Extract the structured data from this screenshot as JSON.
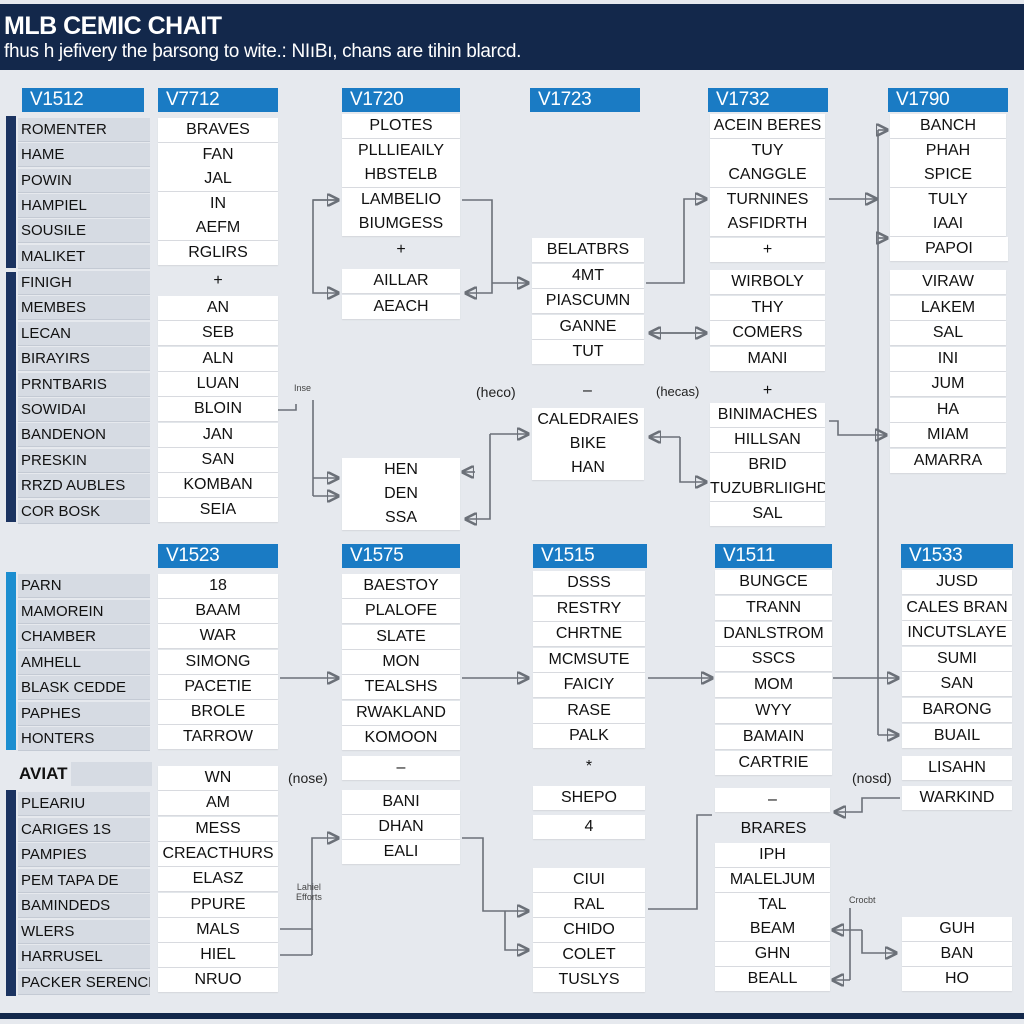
{
  "header": {
    "title": "MLB CEMIC CHAIT",
    "subtitle": "fhus h jefivery the þarsong to wite.: NIıBı, chans are tihin blarcd."
  },
  "colors": {
    "header_bg": "#13284b",
    "column_header": "#1a7bc4",
    "sidebar_dark": "#1b3360",
    "sidebar_blue": "#1c8ed0",
    "background": "#e6e9ee"
  },
  "top_section": {
    "group1": {
      "header": "V1512",
      "labels": [
        "ROMENTER",
        "HAME",
        "POWIN",
        "HAMPIEL",
        "SOUSILE",
        "MALIKET"
      ]
    },
    "group2": {
      "labels": [
        "FINIGH",
        "MEMBES",
        "LECAN",
        "BIRAYIRS",
        "PRNTBARIS",
        "SOWIDAI",
        "BANDENON",
        "PRESKIN",
        "RRZD AUBLES",
        "COR BOSK"
      ]
    },
    "col_v7712": {
      "header": "V7712",
      "values_a": [
        "BRAVES",
        "FAN",
        "JAL",
        "IN",
        "AEFM",
        "RGLIRS"
      ],
      "separator": "+",
      "values_b": [
        "AN",
        "SEB",
        "ALN",
        "LUAN",
        "BLOIN",
        "JAN",
        "SAN",
        "KOMBAN",
        "SEIA"
      ]
    },
    "col_v1720": {
      "header": "V1720",
      "values_a": [
        "PLOTES",
        "PLLLIEAILY",
        "HBSTELB",
        "LAMBELIO",
        "BIUMGESS"
      ],
      "separator": "+",
      "values_b": [
        "AILLAR",
        "AEACH"
      ],
      "values_c": [
        "HEN",
        "DEN",
        "SSA"
      ]
    },
    "col_v1723": {
      "header": "V1723",
      "values_a": [
        "BELATBRS",
        "4MT",
        "PIASCUMN",
        "GANNE",
        "TUT"
      ],
      "separator": "–",
      "values_b": [
        "CALEDRAIES",
        "BIKE",
        "HAN"
      ]
    },
    "col_v1732": {
      "header": "V1732",
      "values_a": [
        "ACEIN BERES",
        "TUY",
        "CANGGLE",
        "TURNINES",
        "ASFIDRTH"
      ],
      "separator_cell": "+",
      "values_b": [
        "WIRBOLY",
        "THY",
        "COMERS",
        "MANI"
      ],
      "separator": "+",
      "values_c": [
        "BINIMACHES",
        "HILLSAN",
        "BRID",
        "TUZUBRLIIGHD",
        "SAL"
      ]
    },
    "col_v1790": {
      "header": "V1790",
      "values_a": [
        "BANCH",
        "PHAH",
        "SPICE",
        "TULY",
        "IAAI"
      ],
      "values_b": [
        "PAPOI"
      ],
      "values_c": [
        "VIRAW",
        "LAKEM",
        "SAL",
        "INI",
        "JUM",
        "HA",
        "MIAM",
        "AMARRA"
      ]
    },
    "notes": {
      "inse": "Inse",
      "heco": "(heco)",
      "hecas": "(hecas)"
    }
  },
  "bottom_section": {
    "group3": {
      "labels": [
        "PARN",
        "MAMOREIN",
        "CHAMBER",
        "AMHELL",
        "BLASK CEDDE",
        "PAPHES",
        "HONTERS"
      ]
    },
    "group4": {
      "title": "AVIAT",
      "labels": [
        "PLEARIU",
        "CARIGES 1S",
        "PAMPIES",
        "PEM TAPA DE",
        "BAMINDEDS",
        "WLERS",
        "HARRUSEL",
        "PACKER SERENCH"
      ]
    },
    "col_v1523": {
      "header": "V1523",
      "values_a": [
        "18",
        "BAAM",
        "WAR",
        "SIMONG",
        "PACETIE",
        "BROLE",
        "TARROW"
      ],
      "values_b": [
        "WN",
        "AM",
        "MESS",
        "CREACTHURS",
        "ELASZ",
        "PPURE",
        "MALS",
        "HIEL",
        "NRUO"
      ]
    },
    "col_v1575": {
      "header": "V1575",
      "values_a": [
        "BAESTOY",
        "PLALOFE",
        "SLATE",
        "MON",
        "TEALSHS",
        "RWAKLAND",
        "KOMOON"
      ],
      "separator_cell": "–",
      "values_b": [
        "BANI",
        "DHAN",
        "EALI"
      ]
    },
    "col_v1515": {
      "header": "V1515",
      "values_a": [
        "DSSS",
        "RESTRY",
        "CHRTNE",
        "MCMSUTE",
        "FAICIY",
        "RASE",
        "PALK"
      ],
      "separator": "*",
      "values_b": [
        "SHEPO",
        "4"
      ],
      "values_c": [
        "CIUI",
        "RAL",
        "CHIDO",
        "COLET",
        "TUSLYS"
      ]
    },
    "col_v1511": {
      "header": "V1511",
      "values_a": [
        "BUNGCE",
        "TRANN",
        "DANLSTROM",
        "SSCS",
        "MOM",
        "WYY",
        "BAMAIN",
        "CARTRIE"
      ],
      "separator_cell": "–",
      "subheading": "BRARES",
      "values_b": [
        "IPH",
        "MALELJUM",
        "TAL",
        "BEAM",
        "GHN",
        "BEALL"
      ]
    },
    "col_v1533": {
      "header": "V1533",
      "values_a": [
        "JUSD",
        "CALES BRAN",
        "INCUTSLAYE",
        "SUMI",
        "SAN",
        "BARONG",
        "BUAIL"
      ],
      "values_b": [
        "LISAHN",
        "WARKIND"
      ],
      "values_c": [
        "GUH",
        "BAN",
        "HO"
      ]
    },
    "notes": {
      "nose1": "(nose)",
      "nose2": "(nosd)",
      "latest_efforts": [
        "Lahiel",
        "Efforts"
      ],
      "crocbt": "Crocbt"
    }
  }
}
